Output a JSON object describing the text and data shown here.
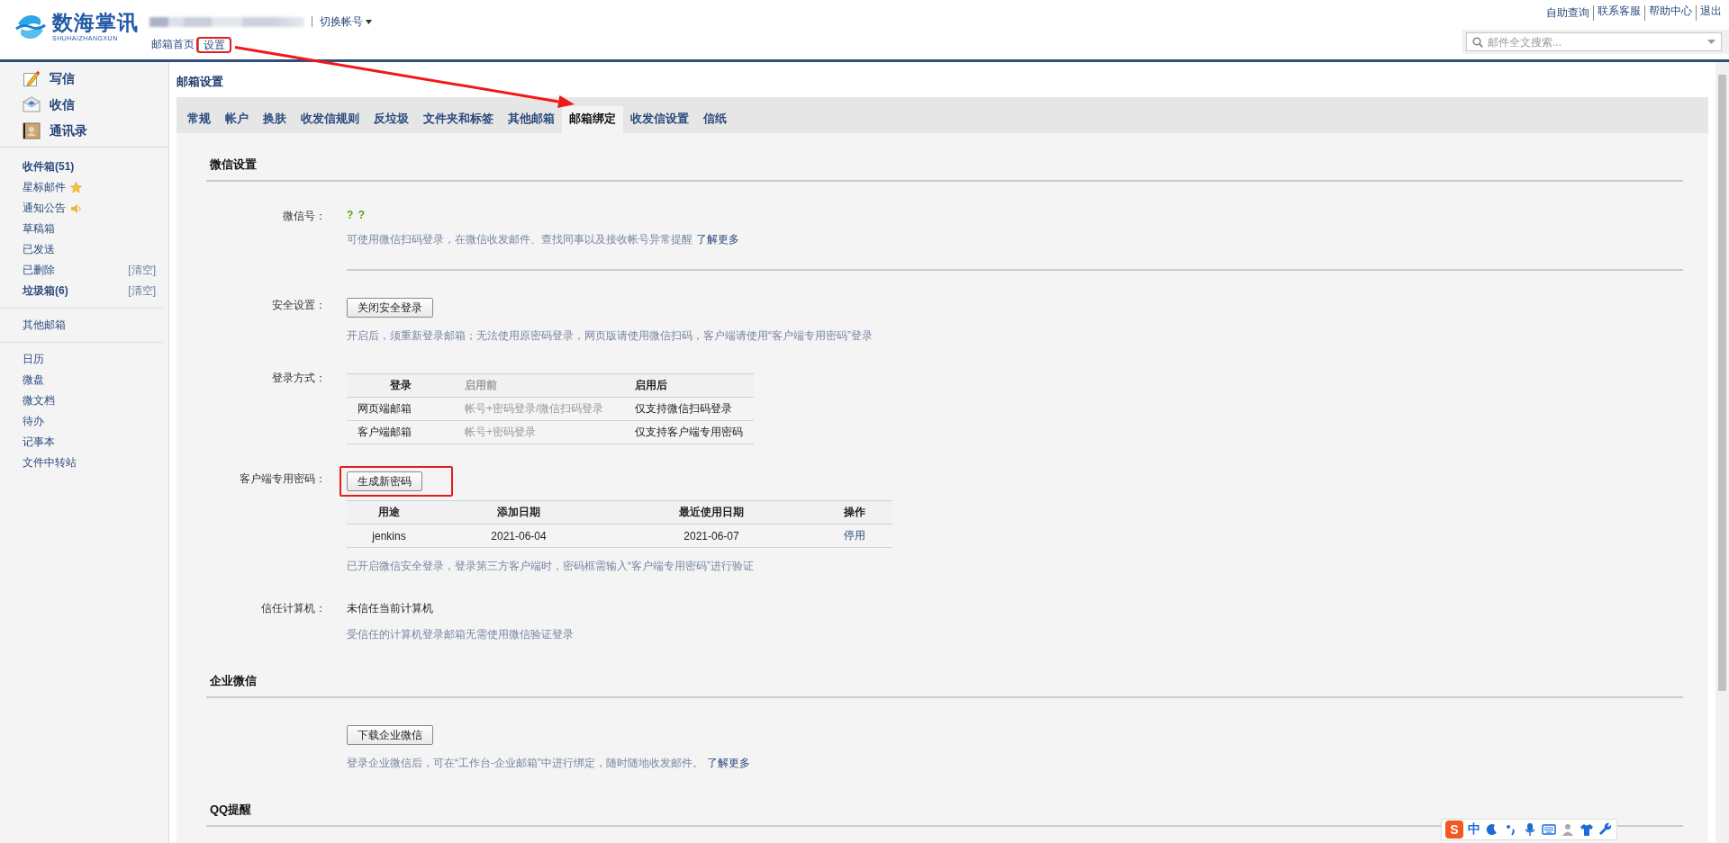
{
  "header": {
    "logo": {
      "name": "数海掌讯",
      "subtitle": "SHUHAIZHANGXUN"
    },
    "account": {
      "kind": "redacted"
    },
    "switch_account": "切换帐号",
    "nav": [
      {
        "label": "邮箱首页",
        "highlighted": false
      },
      {
        "label": "设置",
        "highlighted": true
      }
    ],
    "top_links": [
      "自助查询",
      "联系客服",
      "帮助中心",
      "退出"
    ],
    "search": {
      "placeholder": "邮件全文搜索..."
    }
  },
  "sidebar": {
    "actions": [
      {
        "kind": "compose",
        "label": "写信"
      },
      {
        "kind": "inbox",
        "label": "收信"
      },
      {
        "kind": "contacts",
        "label": "通讯录"
      }
    ],
    "folders": [
      {
        "label": "收件箱(51)",
        "unread": true
      },
      {
        "label": "星标邮件",
        "kind": "starred"
      },
      {
        "label": "通知公告",
        "kind": "notice"
      },
      {
        "label": "草稿箱"
      },
      {
        "label": "已发送"
      },
      {
        "label": "已删除",
        "action": "[清空]"
      },
      {
        "label": "垃圾箱(6)",
        "unread": true,
        "action": "[清空]"
      }
    ],
    "other": [
      {
        "label": "其他邮箱"
      }
    ],
    "apps": [
      {
        "label": "日历"
      },
      {
        "label": "微盘"
      },
      {
        "label": "微文档"
      },
      {
        "label": "待办"
      },
      {
        "label": "记事本"
      },
      {
        "label": "文件中转站"
      }
    ]
  },
  "settings": {
    "title": "邮箱设置",
    "tabs": [
      {
        "label": "常规",
        "selected": false
      },
      {
        "label": "帐户",
        "selected": false
      },
      {
        "label": "换肤",
        "selected": false
      },
      {
        "label": "收发信规则",
        "selected": false
      },
      {
        "label": "反垃圾",
        "selected": false
      },
      {
        "label": "文件夹和标签",
        "selected": false
      },
      {
        "label": "其他邮箱",
        "selected": false
      },
      {
        "label": "邮箱绑定",
        "selected": true,
        "pointed": true
      },
      {
        "label": "收发信设置",
        "selected": false
      },
      {
        "label": "信纸",
        "selected": false
      }
    ],
    "sections": [
      {
        "title": "微信设置",
        "rows": [
          {
            "label": "微信号：",
            "items": [
              {
                "kind": "id",
                "text": "? ?"
              },
              {
                "kind": "note",
                "text": "可使用微信扫码登录，在微信收发邮件、查找同事以及接收帐号异常提醒",
                "link": "了解更多"
              },
              {
                "kind": "rule"
              }
            ]
          },
          {
            "label": "安全设置：",
            "items": [
              {
                "kind": "button",
                "text": "关闭安全登录",
                "highlighted": false
              },
              {
                "kind": "note",
                "text": "开启后，须重新登录邮箱；无法使用原密码登录，网页版请使用微信扫码，客户端请使用“客户端专用密码”登录"
              }
            ]
          },
          {
            "label": "登录方式：",
            "items": [
              {
                "kind": "table",
                "columns": [
                  {
                    "label": "登录",
                    "kind": "plain"
                  },
                  {
                    "label": "启用前",
                    "kind": "muted"
                  },
                  {
                    "label": "启用后",
                    "kind": "plain"
                  }
                ],
                "rows": [
                  [
                    "网页端邮箱",
                    "帐号+密码登录/微信扫码登录",
                    "仅支持微信扫码登录"
                  ],
                  [
                    "客户端邮箱",
                    "帐号+密码登录",
                    "仅支持客户端专用密码"
                  ]
                ]
              }
            ]
          },
          {
            "label": "客户端专用密码：",
            "items": [
              {
                "kind": "button",
                "text": "生成新密码",
                "highlighted": true
              },
              {
                "kind": "table",
                "columns": [
                  {
                    "label": "用途",
                    "kind": "plain"
                  },
                  {
                    "label": "添加日期",
                    "kind": "plain"
                  },
                  {
                    "label": "最近使用日期",
                    "kind": "plain"
                  },
                  {
                    "label": "操作",
                    "kind": "link"
                  }
                ],
                "rows": [
                  [
                    "jenkins",
                    "2021-06-04",
                    "2021-06-07",
                    "停用"
                  ]
                ]
              },
              {
                "kind": "note",
                "text": "已开启微信安全登录，登录第三方客户端时，密码框需输入“客户端专用密码”进行验证"
              }
            ]
          },
          {
            "label": "信任计算机：",
            "items": [
              {
                "kind": "value",
                "text": "未信任当前计算机"
              },
              {
                "kind": "note",
                "text": "受信任的计算机登录邮箱无需使用微信验证登录"
              }
            ]
          }
        ]
      },
      {
        "title": "企业微信",
        "rows": [
          {
            "label": "",
            "items": [
              {
                "kind": "button",
                "text": "下载企业微信",
                "highlighted": false
              },
              {
                "kind": "note",
                "text": "登录企业微信后，可在“工作台-企业邮箱”中进行绑定，随时随地收发邮件。",
                "link": "了解更多"
              }
            ]
          }
        ]
      },
      {
        "title": "QQ提醒"
      }
    ]
  },
  "ime_toolbar": {
    "logo": "S",
    "mode": "中"
  }
}
